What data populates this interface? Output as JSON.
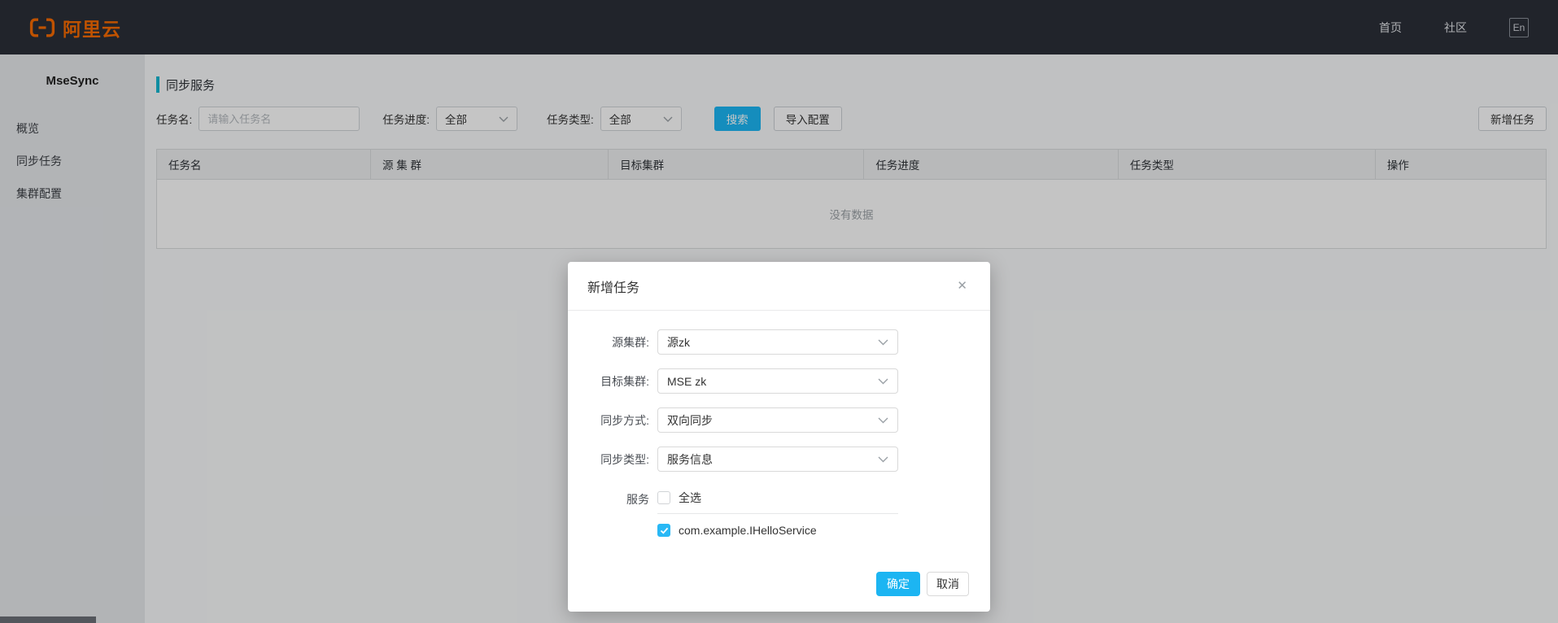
{
  "topbar": {
    "brand": "阿里云",
    "nav_home": "首页",
    "nav_community": "社区",
    "lang": "En"
  },
  "sidebar": {
    "title": "MseSync",
    "items": [
      {
        "label": "概览"
      },
      {
        "label": "同步任务"
      },
      {
        "label": "集群配置"
      }
    ]
  },
  "page": {
    "title": "同步服务",
    "filters": {
      "task_name_label": "任务名:",
      "task_name_placeholder": "请输入任务名",
      "task_name_value": "",
      "progress_label": "任务进度:",
      "progress_value": "全部",
      "type_label": "任务类型:",
      "type_value": "全部",
      "search_label": "搜索",
      "import_label": "导入配置",
      "add_task_label": "新增任务"
    },
    "table": {
      "columns": [
        "任务名",
        "源 集 群",
        "目标集群",
        "任务进度",
        "任务类型",
        "操作"
      ],
      "empty_text": "没有数据"
    }
  },
  "modal": {
    "title": "新增任务",
    "close": "✕",
    "fields": [
      {
        "label": "源集群:",
        "value": "源zk"
      },
      {
        "label": "目标集群:",
        "value": "MSE zk"
      },
      {
        "label": "同步方式:",
        "value": "双向同步"
      },
      {
        "label": "同步类型:",
        "value": "服务信息"
      }
    ],
    "service": {
      "label": "服务",
      "select_all_label": "全选",
      "items": [
        {
          "name": "com.example.IHelloService",
          "checked": true
        }
      ]
    },
    "ok_label": "确定",
    "cancel_label": "取消"
  },
  "colors": {
    "primary_cyan": "#1CB5F2",
    "brand_orange": "#F56A00",
    "accent_teal": "#13B5CF",
    "topbar_bg": "#2B2F38"
  }
}
